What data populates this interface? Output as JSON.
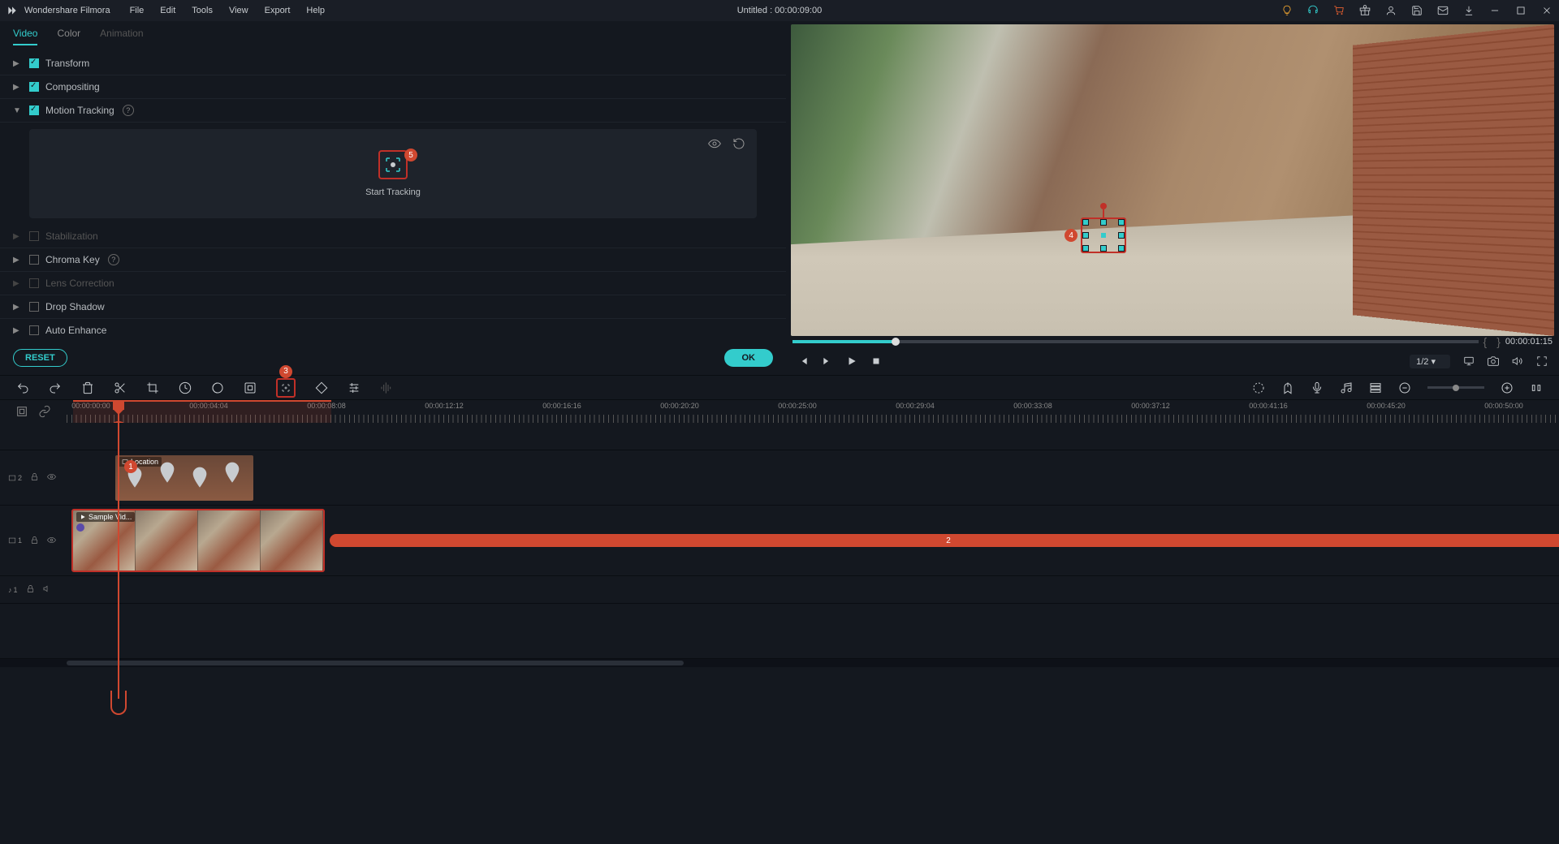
{
  "app_name": "Wondershare Filmora",
  "title": "Untitled : 00:00:09:00",
  "menu": [
    "File",
    "Edit",
    "Tools",
    "View",
    "Export",
    "Help"
  ],
  "tabs": [
    {
      "label": "Video",
      "state": "active"
    },
    {
      "label": "Color",
      "state": "normal"
    },
    {
      "label": "Animation",
      "state": "disabled"
    }
  ],
  "properties": {
    "transform": {
      "label": "Transform",
      "checked": true,
      "expanded": false
    },
    "compositing": {
      "label": "Compositing",
      "checked": true,
      "expanded": false
    },
    "motion_tracking": {
      "label": "Motion Tracking",
      "checked": true,
      "expanded": true
    },
    "stabilization": {
      "label": "Stabilization",
      "checked": false,
      "expanded": false,
      "disabled": true
    },
    "chroma_key": {
      "label": "Chroma Key",
      "checked": false,
      "expanded": false
    },
    "lens_correction": {
      "label": "Lens Correction",
      "checked": false,
      "expanded": false,
      "disabled": true
    },
    "drop_shadow": {
      "label": "Drop Shadow",
      "checked": false,
      "expanded": false
    },
    "auto_enhance": {
      "label": "Auto Enhance",
      "checked": false,
      "expanded": false
    }
  },
  "tracking": {
    "button_label": "Start Tracking",
    "badge": "5"
  },
  "buttons": {
    "reset": "RESET",
    "ok": "OK"
  },
  "preview": {
    "time": "00:00:01:15",
    "zoom": "1/2",
    "tracker_badge": "4"
  },
  "timeline": {
    "motion_tracking_badge": "3",
    "playhead_badge": "1",
    "clip_badge": "2",
    "ruler_times": [
      "00:00:00:00",
      "00:00:04:04",
      "00:00:08:08",
      "00:00:12:12",
      "00:00:16:16",
      "00:00:20:20",
      "00:00:25:00",
      "00:00:29:04",
      "00:00:33:08",
      "00:00:37:12",
      "00:00:41:16",
      "00:00:45:20",
      "00:00:50:00"
    ],
    "tracks": {
      "overlay": {
        "name": "2",
        "clip_label": "Location"
      },
      "video": {
        "name": "1",
        "clip_label": "Sample Vid..."
      },
      "audio": {
        "name": "1"
      }
    }
  },
  "colors": {
    "accent": "#33cccc",
    "highlight_red": "#c03028",
    "badge_orange": "#d04830"
  }
}
